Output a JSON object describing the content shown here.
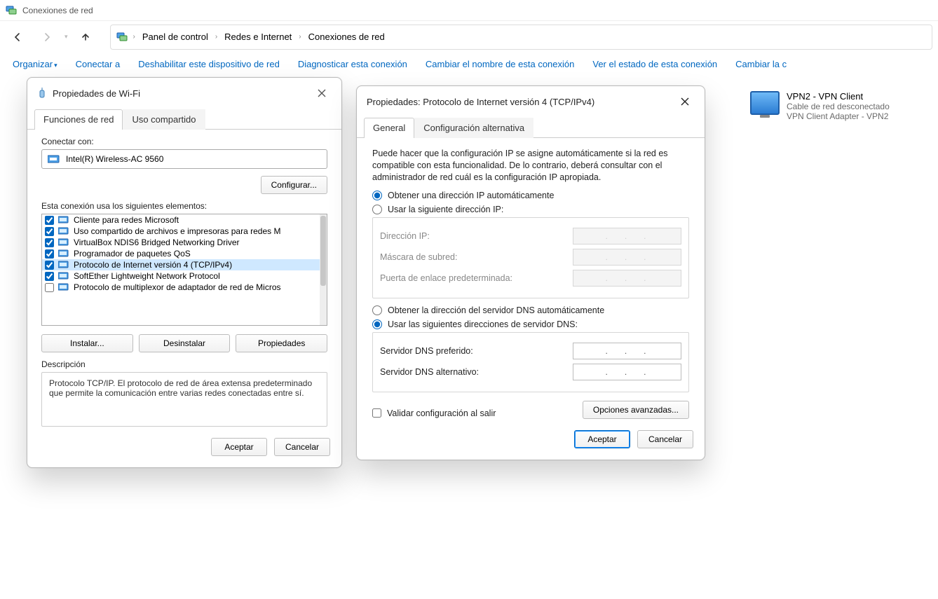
{
  "window": {
    "title": "Conexiones de red"
  },
  "breadcrumb": [
    "Panel de control",
    "Redes e Internet",
    "Conexiones de red"
  ],
  "toolbar": {
    "organize": "Organizar",
    "connect": "Conectar a",
    "disable": "Deshabilitar este dispositivo de red",
    "diagnose": "Diagnosticar esta conexión",
    "rename": "Cambiar el nombre de esta conexión",
    "view_status": "Ver el estado de esta conexión",
    "change": "Cambiar la c"
  },
  "connections": [
    {
      "name": "VPN2 - VPN Client",
      "status": "Cable de red desconectado",
      "detail": "VPN Client Adapter - VPN2"
    }
  ],
  "wifi_dialog": {
    "title": "Propiedades de Wi-Fi",
    "tabs": {
      "functions": "Funciones de red",
      "sharing": "Uso compartido"
    },
    "connect_with": "Conectar con:",
    "adapter": "Intel(R) Wireless-AC 9560",
    "configure_btn": "Configurar...",
    "elements_label": "Esta conexión usa los siguientes elementos:",
    "items": [
      {
        "checked": true,
        "label": "Cliente para redes Microsoft"
      },
      {
        "checked": true,
        "label": "Uso compartido de archivos e impresoras para redes M"
      },
      {
        "checked": true,
        "label": "VirtualBox NDIS6 Bridged Networking Driver"
      },
      {
        "checked": true,
        "label": "Programador de paquetes QoS"
      },
      {
        "checked": true,
        "label": "Protocolo de Internet versión 4 (TCP/IPv4)",
        "selected": true
      },
      {
        "checked": true,
        "label": "SoftEther Lightweight Network Protocol"
      },
      {
        "checked": false,
        "label": "Protocolo de multiplexor de adaptador de red de Micros"
      }
    ],
    "install_btn": "Instalar...",
    "uninstall_btn": "Desinstalar",
    "properties_btn": "Propiedades",
    "desc_label": "Descripción",
    "desc_text": "Protocolo TCP/IP. El protocolo de red de área extensa predeterminado que permite la comunicación entre varias redes conectadas entre sí.",
    "accept": "Aceptar",
    "cancel": "Cancelar"
  },
  "ipv4_dialog": {
    "title": "Propiedades: Protocolo de Internet versión 4 (TCP/IPv4)",
    "tabs": {
      "general": "General",
      "alt": "Configuración alternativa"
    },
    "intro": "Puede hacer que la configuración IP se asigne automáticamente si la red es compatible con esta funcionalidad. De lo contrario, deberá consultar con el administrador de red cuál es la configuración IP apropiada.",
    "ip_auto": "Obtener una dirección IP automáticamente",
    "ip_manual": "Usar la siguiente dirección IP:",
    "ip_label": "Dirección IP:",
    "mask_label": "Máscara de subred:",
    "gw_label": "Puerta de enlace predeterminada:",
    "dns_auto": "Obtener la dirección del servidor DNS automáticamente",
    "dns_manual": "Usar las siguientes direcciones de servidor DNS:",
    "dns_pref": "Servidor DNS preferido:",
    "dns_alt": "Servidor DNS alternativo:",
    "validate": "Validar configuración al salir",
    "advanced": "Opciones avanzadas...",
    "accept": "Aceptar",
    "cancel": "Cancelar",
    "ip_choice": "auto",
    "dns_choice": "manual"
  }
}
